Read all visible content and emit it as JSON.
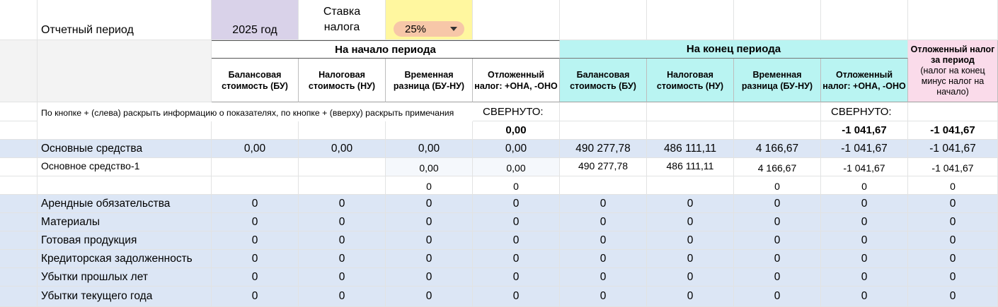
{
  "top": {
    "period_label": "Отчетный период",
    "period_value": "2025 год",
    "rate_label_line1": "Ставка",
    "rate_label_line2": "налога",
    "rate_value": "25%"
  },
  "groups": {
    "start": "На начало периода",
    "end": "На конец периода",
    "period_tax": "Отложенный налог за период",
    "period_tax_note": "(налог на конец минус налог на начало)"
  },
  "columns": {
    "bv": "Балансовая стоимость (БУ)",
    "tv": "Налоговая стоимость (НУ)",
    "diff": "Временная разница (БУ-НУ)",
    "dt": "Отложенный налог: +ОНА, -ОНО"
  },
  "note_text": "По кнопке + (слева) раскрыть информацию о показателях, по кнопке + (вверху) раскрыть примечания",
  "collapsed_start": "СВЕРНУТО:",
  "collapsed_end": "СВЕРНУТО:",
  "totals": {
    "start_dt": "0,00",
    "end_dt": "-1 041,67",
    "period": "-1 041,67"
  },
  "rows": [
    {
      "label": "Основные средства",
      "v": [
        "0,00",
        "0,00",
        "0,00",
        "0,00",
        "490 277,78",
        "486 111,11",
        "4 166,67",
        "-1 041,67",
        "-1 041,67"
      ]
    },
    {
      "label": "Основное средство-1",
      "v": [
        "",
        "",
        "0,00",
        "0,00",
        "490 277,78",
        "486 111,11",
        "4 166,67",
        "-1 041,67",
        "-1 041,67"
      ]
    },
    {
      "label": "",
      "v": [
        "",
        "",
        "0",
        "0",
        "",
        "",
        "0",
        "0",
        "0"
      ]
    },
    {
      "label": "Арендные обязательства",
      "v": [
        "0",
        "0",
        "0",
        "0",
        "0",
        "0",
        "0",
        "0",
        "0"
      ]
    },
    {
      "label": "Материалы",
      "v": [
        "0",
        "0",
        "0",
        "0",
        "0",
        "0",
        "0",
        "0",
        "0"
      ]
    },
    {
      "label": "Готовая продукция",
      "v": [
        "0",
        "0",
        "0",
        "0",
        "0",
        "0",
        "0",
        "0",
        "0"
      ]
    },
    {
      "label": "Кредиторская задолженность",
      "v": [
        "0",
        "0",
        "0",
        "0",
        "0",
        "0",
        "0",
        "0",
        "0"
      ]
    },
    {
      "label": "Убытки прошлых лет",
      "v": [
        "0",
        "0",
        "0",
        "0",
        "0",
        "0",
        "0",
        "0",
        "0"
      ]
    },
    {
      "label": "Убытки текущего года",
      "v": [
        "0",
        "0",
        "0",
        "0",
        "0",
        "0",
        "0",
        "0",
        "0"
      ]
    }
  ]
}
